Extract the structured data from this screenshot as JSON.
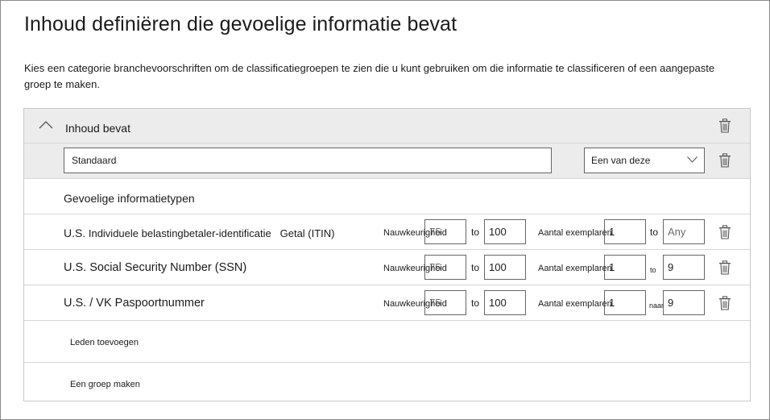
{
  "page": {
    "title": "Inhoud definiëren die gevoelige informatie bevat",
    "description": "Kies een categorie branchevoorschriften om de classificatiegroepen te zien die u kunt gebruiken om die informatie te classificeren of een aangepaste groep te maken."
  },
  "group": {
    "header_label": "Inhoud bevat",
    "name_value": "Standaard",
    "operator_selected": "Een van deze",
    "section_label": "Gevoelige informatietypen"
  },
  "types": [
    {
      "name_prefix": "U.S.",
      "name_main": " Individuele belastingbetaler-identificatie",
      "name_suffix": "   Getal (ITIN)",
      "accuracy_label": "Nauwkeurigheid",
      "accuracy_min": "75",
      "to_accuracy": "to",
      "accuracy_max": "100",
      "count_label": "Aantal exemplaren",
      "count_min": "1",
      "to_count": "to",
      "count_max": "Any"
    },
    {
      "name": "U.S. Social Security Number (SSN)",
      "accuracy_label": "Nauwkeurigheid",
      "accuracy_min": "75",
      "to_accuracy": "to",
      "accuracy_max": "100",
      "count_label": "Aantal exemplaren",
      "count_min": "1",
      "to_count": "to",
      "count_max": "9"
    },
    {
      "name": "U.S. / VK Paspoortnummer",
      "accuracy_label": "Nauwkeurigheid",
      "accuracy_min": "75",
      "to_accuracy": "to",
      "accuracy_max": "100",
      "count_label": "Aantal exemplaren",
      "count_min": "1",
      "to_count": "naar",
      "count_max": "9"
    }
  ],
  "actions": {
    "add_members": "Leden toevoegen",
    "create_group": "Een groep maken"
  },
  "icons": {
    "collapse": "chevron-up-icon",
    "delete": "trash-icon",
    "dropdown": "chevron-down-icon"
  }
}
